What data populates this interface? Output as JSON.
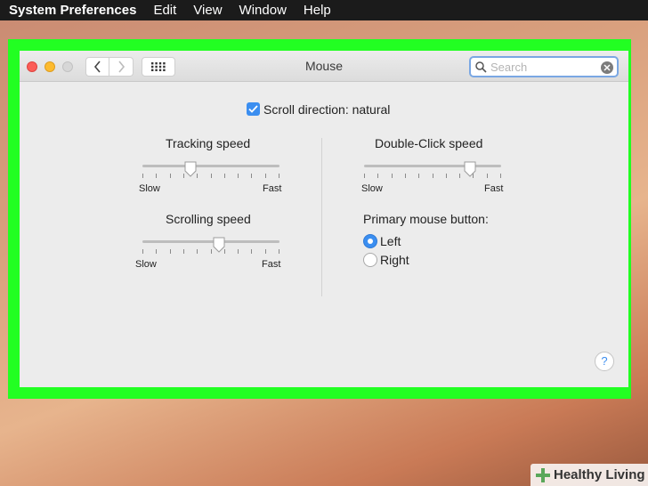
{
  "menubar": {
    "app_name": "System Preferences",
    "items": [
      "Edit",
      "View",
      "Window",
      "Help"
    ]
  },
  "window": {
    "title": "Mouse",
    "search": {
      "placeholder": "Search",
      "value": ""
    }
  },
  "settings": {
    "scroll_direction": {
      "label": "Scroll direction: natural",
      "checked": true
    },
    "tracking_speed": {
      "label": "Tracking speed",
      "min_label": "Slow",
      "max_label": "Fast",
      "level": 0.35
    },
    "scrolling_speed": {
      "label": "Scrolling speed",
      "min_label": "Slow",
      "max_label": "Fast",
      "level": 0.56
    },
    "double_click_speed": {
      "label": "Double-Click speed",
      "min_label": "Slow",
      "max_label": "Fast",
      "level": 0.77
    },
    "primary_mouse_button": {
      "label": "Primary mouse button:",
      "options": [
        {
          "label": "Left",
          "selected": true
        },
        {
          "label": "Right",
          "selected": false
        }
      ]
    },
    "help_label": "?"
  },
  "watermark": {
    "text": "Healthy Living"
  },
  "colors": {
    "highlight": "#22ff22",
    "accent": "#3b8ef0",
    "menubar": "#1b1b1b"
  }
}
